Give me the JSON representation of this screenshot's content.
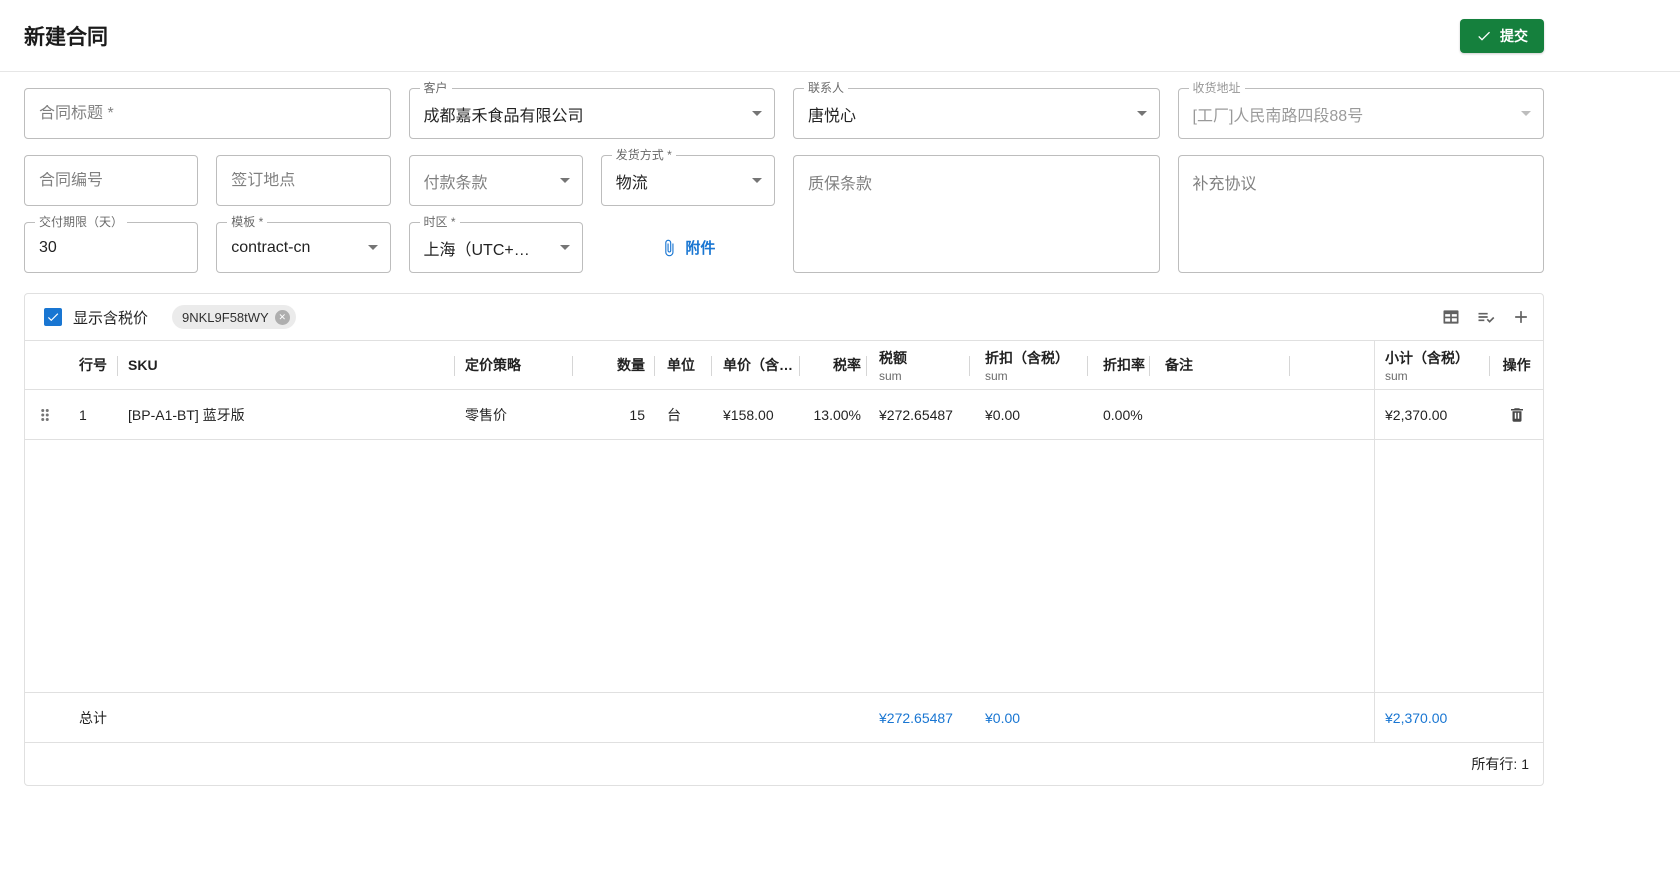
{
  "colors": {
    "submit_green": "#15803d",
    "primary_blue": "#1976d2"
  },
  "header": {
    "title": "新建合同",
    "submit_label": "提交"
  },
  "form": {
    "contract_title": {
      "label": "合同标题 *",
      "value": ""
    },
    "customer": {
      "label": "客户",
      "value": "成都嘉禾食品有限公司"
    },
    "contact": {
      "label": "联系人",
      "value": "唐悦心"
    },
    "shipping_address": {
      "label": "收货地址",
      "value": "[工厂]人民南路四段88号"
    },
    "contract_no": {
      "label": "合同编号",
      "value": ""
    },
    "signing_place": {
      "label": "签订地点",
      "value": ""
    },
    "payment_terms": {
      "label": "付款条款",
      "value": ""
    },
    "delivery_method": {
      "label": "发货方式 *",
      "value": "物流"
    },
    "warranty": {
      "label": "质保条款",
      "value": ""
    },
    "supplement": {
      "label": "补充协议",
      "value": ""
    },
    "delivery_days": {
      "label": "交付期限（天）",
      "value": "30"
    },
    "template": {
      "label": "模板 *",
      "value": "contract-cn"
    },
    "timezone": {
      "label": "时区 *",
      "value": "上海（UTC+…"
    },
    "attachment_label": "附件"
  },
  "grid": {
    "toolbar": {
      "show_tax_label": "显示含税价",
      "chip_label": "9NKL9F58tWY"
    },
    "columns": {
      "row_no": "行号",
      "sku": "SKU",
      "pricing": "定价策略",
      "qty": "数量",
      "unit": "单位",
      "unit_price": "单价（含…",
      "tax_rate": "税率",
      "tax_amount": "税额",
      "discount": "折扣（含税）",
      "discount_rate": "折扣率",
      "remark": "备注",
      "subtotal": "小计（含税）",
      "actions": "操作",
      "agg_label": "sum"
    },
    "rows": [
      {
        "row_no": "1",
        "sku": "[BP-A1-BT] 蓝牙版",
        "pricing": "零售价",
        "qty": "15",
        "unit": "台",
        "unit_price": "¥158.00",
        "tax_rate": "13.00%",
        "tax_amount": "¥272.65487",
        "discount": "¥0.00",
        "discount_rate": "0.00%",
        "remark": "",
        "subtotal": "¥2,370.00"
      }
    ],
    "total_row": {
      "label": "总计",
      "tax_amount": "¥272.65487",
      "discount": "¥0.00",
      "subtotal": "¥2,370.00"
    },
    "footer": "所有行: 1"
  }
}
